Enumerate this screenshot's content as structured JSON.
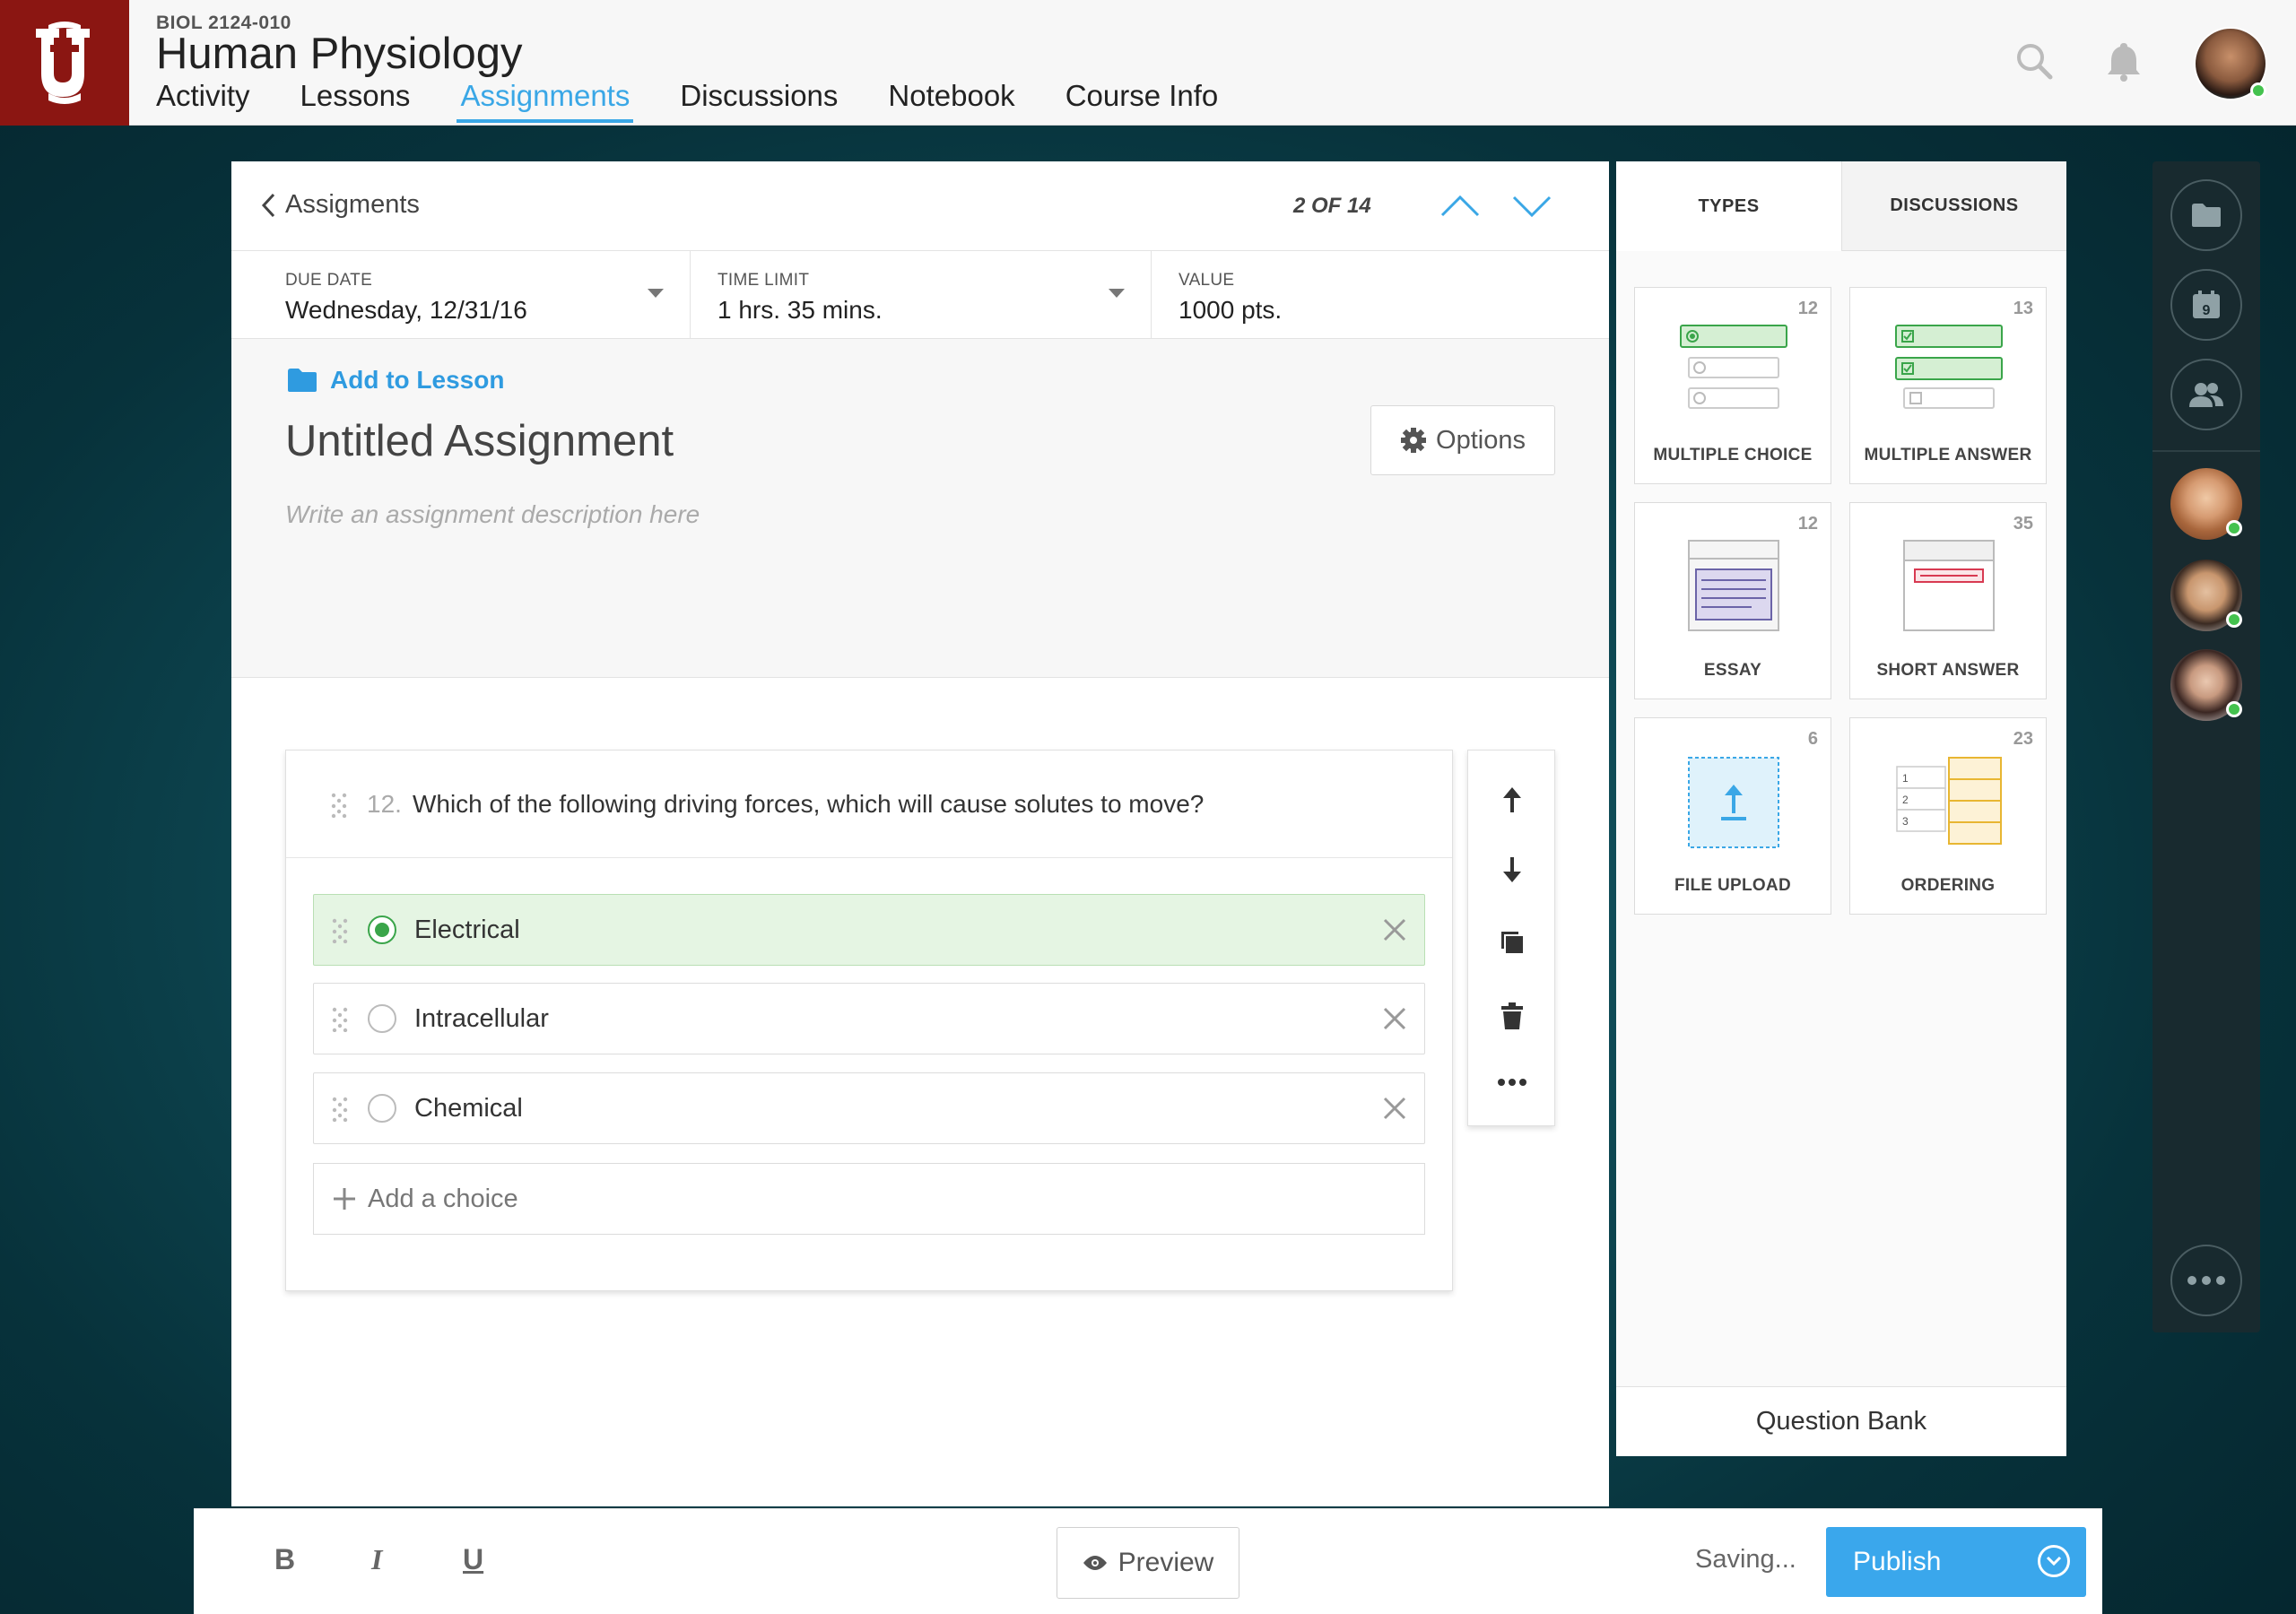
{
  "header": {
    "course_code": "BIOL 2124-010",
    "course_title": "Human Physiology",
    "nav": [
      "Activity",
      "Lessons",
      "Assignments",
      "Discussions",
      "Notebook",
      "Course Info"
    ],
    "active_nav": "Assignments"
  },
  "assignment": {
    "back_label": "Assigments",
    "counter": "2 OF 14",
    "due_date_label": "DUE DATE",
    "due_date_value": "Wednesday, 12/31/16",
    "time_limit_label": "TIME LIMIT",
    "time_limit_value": "1 hrs. 35 mins.",
    "value_label": "VALUE",
    "value_value": "1000 pts.",
    "add_to_lesson": "Add to Lesson",
    "title": "Untitled Assignment",
    "options_label": "Options",
    "description_placeholder": "Write an assignment description here"
  },
  "question": {
    "number": "12.",
    "text": "Which of the following driving forces, which will cause solutes to move?",
    "choices": [
      {
        "label": "Electrical",
        "selected": true
      },
      {
        "label": "Intracellular",
        "selected": false
      },
      {
        "label": "Chemical",
        "selected": false
      }
    ],
    "add_choice": "Add a choice"
  },
  "types_panel": {
    "tabs": [
      "TYPES",
      "DISCUSSIONS"
    ],
    "types": [
      {
        "label": "MULTIPLE CHOICE",
        "count": "12"
      },
      {
        "label": "MULTIPLE ANSWER",
        "count": "13"
      },
      {
        "label": "ESSAY",
        "count": "12"
      },
      {
        "label": "SHORT ANSWER",
        "count": "35"
      },
      {
        "label": "FILE UPLOAD",
        "count": "6"
      },
      {
        "label": "ORDERING",
        "count": "23"
      }
    ],
    "ordering_numbers": [
      "1",
      "2",
      "3"
    ],
    "question_bank": "Question Bank"
  },
  "dock": {
    "calendar_day": "9"
  },
  "toolbar": {
    "bold": "B",
    "italic": "I",
    "underline": "U",
    "preview": "Preview",
    "saving": "Saving...",
    "publish": "Publish"
  },
  "colors": {
    "brand": "#8b1612",
    "accent": "#3aa7e6",
    "success": "#3aa54a",
    "selected_bg": "#e5f5e3"
  }
}
